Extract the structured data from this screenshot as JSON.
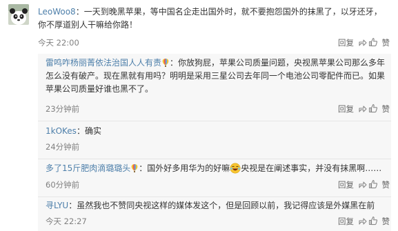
{
  "main_comment": {
    "username": "LeoWoo8",
    "separator": "：",
    "text": "一天到晚黑苹果，等中国名企走出国外时，就不要抱怨国外的抹黑了，以牙还牙，你不厚道别人干嘛给你路！",
    "time": "今天 22:00",
    "reply_label": "回复",
    "like_label": "赞"
  },
  "replies": [
    {
      "username": "雷鸣咋杨丽菁依法治国人人有责",
      "text_before": "：你放狗屁，苹果公司质量问题，央视黑苹果公司那么多年怎么没有破产。现在黑就有用吗？明明是采用三星公司去年同一个电池公司零配件而已。如果苹果公司质量好谁也黑不了。",
      "time": "23分钟前",
      "reply_label": "回复",
      "like_label": "赞"
    },
    {
      "username": "1kOKes",
      "text_before": "：确实",
      "time": "24分钟前"
    },
    {
      "username": "多了15斤肥肉滴璐璐头",
      "text_before": "：国外好多用华为的好嘛",
      "text_after": "央视是在阐述事实，并没有抹黑啊……",
      "time": "60分钟前",
      "reply_label": "回复",
      "like_label": "赞"
    },
    {
      "username": "寻LYU",
      "text_before": "：虽然我也不赞同央视这样的媒体发这个，但是回顾以前，我记得应该是外媒黑在前",
      "time": "今天 22:27",
      "reply_label": "回复",
      "like_label": "赞"
    }
  ],
  "colors": {
    "username": "#4d7faa",
    "text": "#333333",
    "meta": "#808080",
    "reply_bg": "#f7f7f7"
  },
  "icons": [
    "panda-avatar",
    "share-icon",
    "like-icon",
    "vip-balloon-icon",
    "laugh-emoji-icon"
  ]
}
